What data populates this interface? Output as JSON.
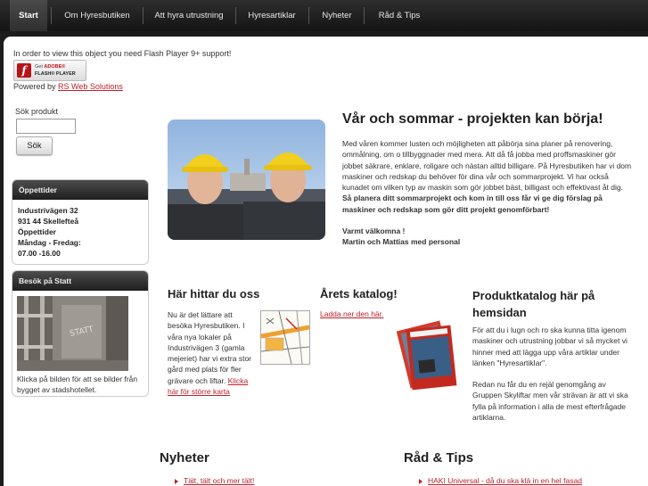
{
  "nav": {
    "items": [
      {
        "label": "Start",
        "active": true
      },
      {
        "label": "Om Hyresbutiken"
      },
      {
        "label": "Att hyra utrustning"
      },
      {
        "label": "Hyresartiklar"
      },
      {
        "label": "Nyheter"
      },
      {
        "label": "Råd & Tips"
      }
    ]
  },
  "flash": {
    "note": "In order to view this object you need Flash Player 9+ support!",
    "badge_line1_a": "Get ",
    "badge_line1_b": "ADOBE®",
    "badge_line2": "FLASH® PLAYER",
    "logo_glyph": "f"
  },
  "powered": {
    "prefix": "Powered by ",
    "link": "RS Web Solutions"
  },
  "search": {
    "label": "Sök produkt",
    "value": "",
    "button": "Sök"
  },
  "hours": {
    "title": "Öppettider",
    "lines": [
      "Industrivägen 32",
      "931 44 Skellefteå",
      "Öppettider",
      "Måndag - Fredag:",
      "07.00 -16.00"
    ]
  },
  "visit": {
    "title": "Besök på Statt",
    "caption": "Klicka på bilden för att se bilder från bygget av stadshotellet."
  },
  "main": {
    "title": "Vår och sommar - projekten kan börja!",
    "paragraph": "Med våren kommer lusten och möjligheten att påbörja sina planer på renovering, ommålning, om o tillbyggnader med mera. Att då få jobba med proffsmaskiner gör jobbet säkrare, enklare, roligare och nästan alltid billigare. På Hyresbutiken har vi dom maskiner och redskap du behöver för dina vår och sommarprojekt. Vi har också kunadet om vilken typ av maskin som gör jobbet bäst, billigast och effektivast åt dig.",
    "bold_paragraph": "Så planera ditt sommarprojekt och kom in till oss får vi ge dig förslag på maskiner och redskap som gör ditt projekt genomförbart!",
    "welcome": "Varmt välkomna !",
    "signature": "Martin och Mattias med personal"
  },
  "find_us": {
    "title": "Här hittar du oss",
    "text": "Nu är det lättare att besöka Hyresbutiken. I våra nya lokaler på Industrivägen 3 (gamla mejeriet) har vi extra stor gård med plats för fler grävare och liftar.",
    "link": "Klicka här för större karta"
  },
  "catalog": {
    "title": "Årets katalog!",
    "link": "Ladda ner den här."
  },
  "product_catalog": {
    "title_line1": "Produktkatalog här på",
    "title_line2": "hemsidan",
    "p1": "För att du i lugn och ro ska kunna titta igenom maskiner och utrustning jobbar vi så mycket vi hinner med att lägga upp våra artiklar under länken \"Hyresartiklar\".",
    "p2": "Redan nu får du en rejäl genomgång av Gruppen Skyliftar men vår strävan är att vi ska fylla på information i alla de mest efterfrågade artiklarna."
  },
  "news": {
    "title": "Nyheter",
    "items": [
      "Tält, tält och mer tält!"
    ]
  },
  "tips": {
    "title": "Råd & Tips",
    "items": [
      "HAKI Universal - då du ska klä in en hel fasad"
    ]
  },
  "colors": {
    "accent": "#c0202a",
    "nav_bg": "#1c1c1c",
    "helmet": "#f2cf1c"
  }
}
